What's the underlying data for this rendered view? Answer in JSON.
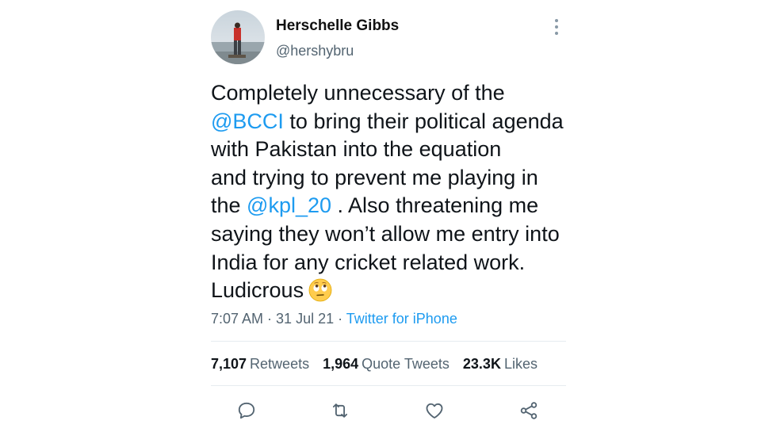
{
  "author": {
    "name": "Herschelle Gibbs",
    "handle": "@hershybru"
  },
  "tweet": {
    "lines": [
      [
        {
          "text": "Completely unnecessary of the",
          "mention": false
        }
      ],
      [
        {
          "text": "@BCCI",
          "mention": true
        },
        {
          "text": " to bring their political agenda",
          "mention": false
        }
      ],
      [
        {
          "text": "with Pakistan into the equation",
          "mention": false
        }
      ],
      [
        {
          "text": "and trying to prevent me playing in",
          "mention": false
        }
      ],
      [
        {
          "text": "the ",
          "mention": false
        },
        {
          "text": "@kpl_20",
          "mention": true
        },
        {
          "text": " . Also threatening me",
          "mention": false
        }
      ],
      [
        {
          "text": "saying they won’t allow me entry into",
          "mention": false
        }
      ],
      [
        {
          "text": "India for any cricket related work.",
          "mention": false
        }
      ],
      [
        {
          "text": "Ludicrous",
          "mention": false
        }
      ]
    ],
    "trailing_emoji": "face-with-rolling-eyes"
  },
  "meta": {
    "time": "7:07 AM",
    "separator": " · ",
    "date": "31 Jul 21",
    "source": "Twitter for iPhone"
  },
  "stats": {
    "retweets_count": "7,107",
    "retweets_label": "Retweets",
    "quotes_count": "1,964",
    "quotes_label": "Quote Tweets",
    "likes_count": "23.3K",
    "likes_label": "Likes"
  },
  "colors": {
    "accent": "#1d9bf0",
    "secondary_text": "#536471",
    "primary_text": "#0f1419",
    "icon": "#536471"
  },
  "icons": {
    "reply": "speech-bubble-icon",
    "retweet": "retweet-arrows-icon",
    "like": "heart-icon",
    "share": "share-nodes-icon",
    "more": "vertical-ellipsis-icon"
  }
}
